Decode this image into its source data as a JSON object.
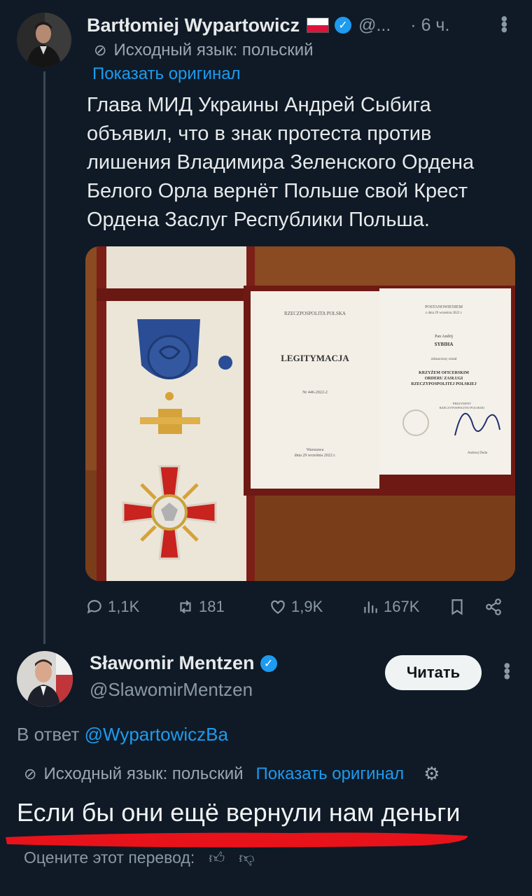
{
  "tweet": {
    "author": {
      "display_name": "Bartłomiej Wypartowicz",
      "handle": "@...",
      "time": "· 6 ч.",
      "flag_icon": "poland-flag-icon",
      "verified_color": "#1d9bf0"
    },
    "translation": {
      "source_language": "Исходный язык: польский",
      "show_original": "Показать оригинал"
    },
    "text_lines": [
      "Глава МИД Украины Андрей Сыбига",
      "объявил, что в знак протеста против",
      "лишения Владимира Зеленского Ордена",
      "Белого Орла вернёт Польше свой Крест",
      "Ордена Заслуг Республики Польша."
    ],
    "photo": {
      "certificate_left_header": "RZECZPOSPOLITA POLSKA",
      "certificate_title": "LEGITYMACJA",
      "certificate_number": "Nr 446-2022-2",
      "certificate_place": "Warszawa",
      "certificate_date": "dnia 29 września 2022 r.",
      "right_header": "POSTANOWIENIEM",
      "right_date": "z dnia 29 września 2022 r.",
      "recipient_prefix": "Pan Andrij",
      "recipient_name": "SYBIHA",
      "awarded": "odznaczony został",
      "award_line1": "KRZYŻEM OFICERSKIM",
      "award_line2": "ORDERU ZASŁUGI",
      "award_line3": "RZECZYPOSPOLITEJ POLSKIEJ",
      "president_line1": "PREZYDENT",
      "president_line2": "RZECZYPOSPOLITEJ POLSKIEJ",
      "signature_name": "Andrzej Duda"
    },
    "actions": {
      "replies": "1,1K",
      "reposts": "181",
      "likes": "1,9K",
      "views": "167K"
    }
  },
  "reply": {
    "author": {
      "display_name": "Sławomir Mentzen",
      "handle": "@SlawomirMentzen"
    },
    "follow_label": "Читать",
    "reply_to_prefix": "В ответ",
    "reply_to_handle": "@WypartowiczBa",
    "translation": {
      "source_language": "Исходный язык: польский",
      "show_original": "Показать оригинал"
    },
    "translated_text": "Если бы они ещё вернули нам деньги",
    "rate_translation": "Оцените этот перевод:",
    "highlight_color": "#e8121b"
  }
}
